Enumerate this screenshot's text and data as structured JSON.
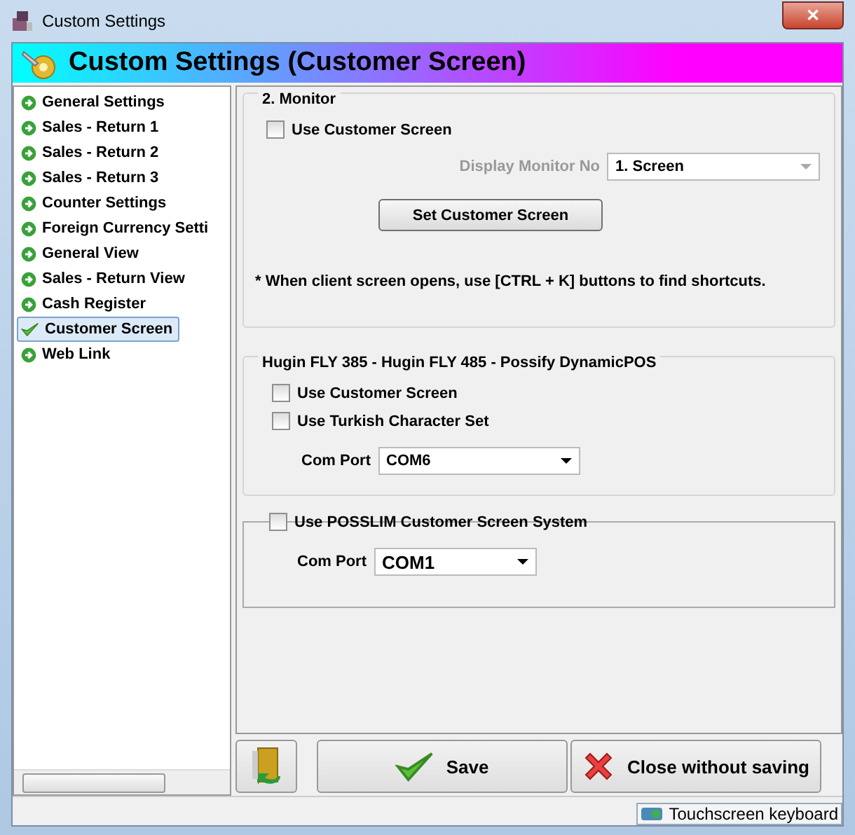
{
  "window": {
    "title": "Custom Settings",
    "close": "✕"
  },
  "header": {
    "title": "Custom Settings (Customer Screen)"
  },
  "sidebar": {
    "items": [
      {
        "label": "General Settings",
        "selected": false
      },
      {
        "label": "Sales - Return 1",
        "selected": false
      },
      {
        "label": "Sales - Return 2",
        "selected": false
      },
      {
        "label": "Sales - Return 3",
        "selected": false
      },
      {
        "label": "Counter Settings",
        "selected": false
      },
      {
        "label": "Foreign Currency Setti",
        "selected": false
      },
      {
        "label": "General View",
        "selected": false
      },
      {
        "label": "Sales - Return View",
        "selected": false
      },
      {
        "label": "Cash Register",
        "selected": false
      },
      {
        "label": "Customer Screen",
        "selected": true
      },
      {
        "label": "Web Link",
        "selected": false
      }
    ]
  },
  "monitor": {
    "title": "2. Monitor",
    "use_customer_screen": {
      "label": "Use Customer Screen",
      "checked": false
    },
    "display_monitor": {
      "label": "Display Monitor No",
      "value": "1. Screen",
      "disabled": true
    },
    "set_button": "Set Customer Screen",
    "note": "* When client screen opens, use [CTRL + K] buttons to find shortcuts."
  },
  "hugin": {
    "title": "Hugin FLY 385 - Hugin FLY 485 - Possify DynamicPOS",
    "options": [
      {
        "label": "Use Customer Screen",
        "checked": false
      },
      {
        "label": "Use Turkish Character Set",
        "checked": false
      }
    ],
    "com_port": {
      "label": "Com Port",
      "value": "COM6"
    }
  },
  "posslim": {
    "option": {
      "label": "Use POSSLIM Customer Screen System",
      "checked": false
    },
    "com_port": {
      "label": "Com Port",
      "value": "COM1"
    }
  },
  "buttons": [
    {
      "kind": "back"
    },
    {
      "kind": "save",
      "label": "Save"
    },
    {
      "kind": "close",
      "label": "Close without saving"
    }
  ],
  "status_bar": {
    "keyboard": "Touchscreen keyboard"
  }
}
